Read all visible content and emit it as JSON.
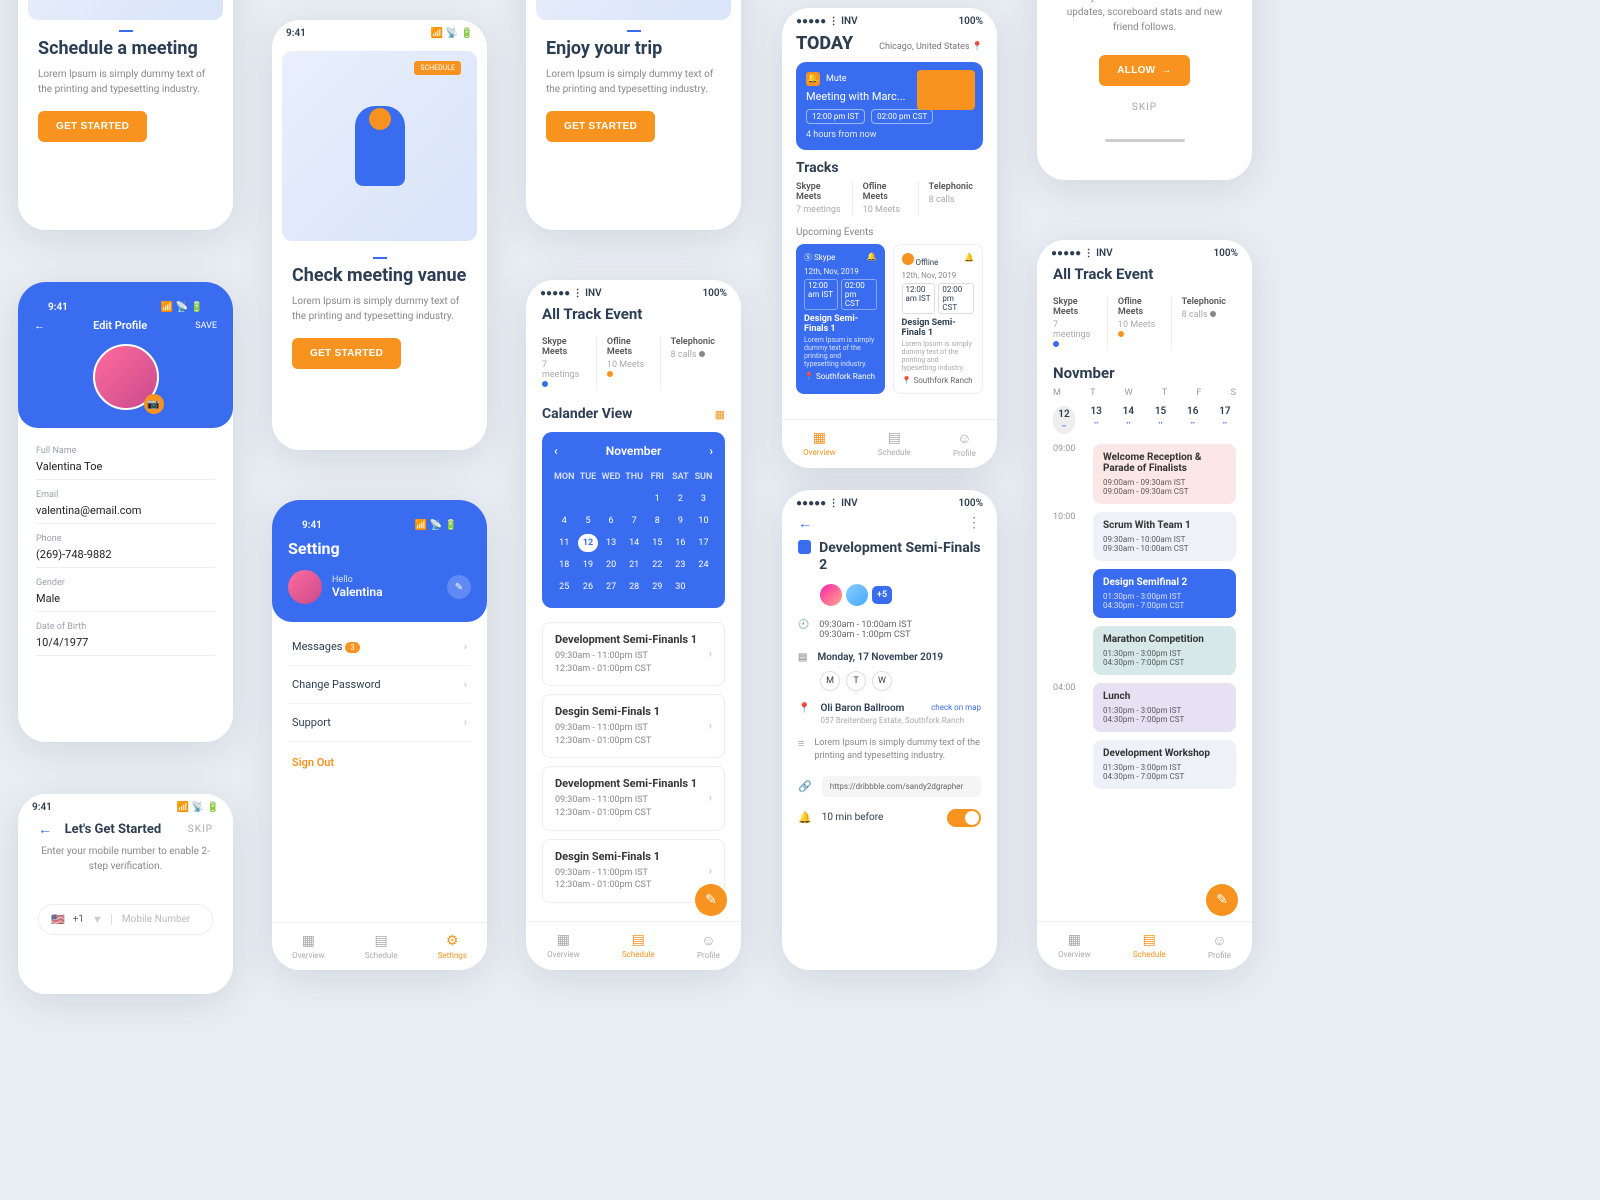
{
  "common": {
    "lorem": "Lorem Ipsum is simply dummy text of the printing and typesetting industry.",
    "getStarted": "GET STARTED"
  },
  "s1": {
    "title": "Schedule a meeting"
  },
  "s2": {
    "title": "Check meeting vanue"
  },
  "s3": {
    "title": "Enjoy your trip"
  },
  "edit": {
    "time": "9:41",
    "header": "Edit Profile",
    "save": "SAVE",
    "back": "←",
    "labels": {
      "name": "Full Name",
      "email": "Email",
      "phone": "Phone",
      "gender": "Gender",
      "dob": "Date of Birth"
    },
    "vals": {
      "name": "Valentina Toe",
      "email": "valentina@email.com",
      "phone": "(269)-748-9882",
      "gender": "Male",
      "dob": "10/4/1977"
    }
  },
  "setting": {
    "time": "9:41",
    "title": "Setting",
    "hello": "Hello",
    "user": "Valentina",
    "messages": "Messages",
    "msgBadge": "3",
    "changePw": "Change Password",
    "support": "Support",
    "signOut": "Sign Out",
    "nav": {
      "overview": "Overview",
      "schedule": "Schedule",
      "settings": "Settings"
    }
  },
  "getStart": {
    "time": "9:41",
    "skip": "SKIP",
    "title": "Let's Get Started",
    "sub": "Enter your mobile number to enable 2-step verification.",
    "code": "+1",
    "ph": "Mobile Number"
  },
  "calview": {
    "sb": "●●●●● ⋮ INV",
    "bat": "100%",
    "title": "All Track Event",
    "tracks": [
      {
        "n": "Skype Meets",
        "c": "7 meetings"
      },
      {
        "n": "Ofline Meets",
        "c": "10 Meets"
      },
      {
        "n": "Telephonic",
        "c": "8 calls"
      }
    ],
    "calTitle": "Calander View",
    "month": "November",
    "wd": [
      "MON",
      "TUE",
      "WED",
      "THU",
      "FRI",
      "SAT",
      "SUN"
    ],
    "days": [
      "",
      "",
      "",
      "",
      "1",
      "2",
      "3",
      "4",
      "5",
      "6",
      "7",
      "8",
      "9",
      "10",
      "11",
      "12",
      "13",
      "14",
      "15",
      "16",
      "17",
      "18",
      "19",
      "20",
      "21",
      "22",
      "23",
      "24",
      "25",
      "26",
      "27",
      "28",
      "29",
      "30",
      ""
    ],
    "sel": "12",
    "events": [
      {
        "t": "Development Semi-Finanls 1",
        "a": "09:30am - 11:00pm IST",
        "b": "12:30am - 01:00pm CST"
      },
      {
        "t": "Desgin Semi-Finals 1",
        "a": "09:30am - 11:00pm IST",
        "b": "12:30am - 01:00pm CST"
      },
      {
        "t": "Development Semi-Finanls 1",
        "a": "09:30am - 11:00pm IST",
        "b": "12:30am - 01:00pm CST"
      },
      {
        "t": "Desgin Semi-Finals 1",
        "a": "09:30am - 11:00pm IST",
        "b": "12:30am - 01:00pm CST"
      }
    ],
    "nav": {
      "overview": "Overview",
      "schedule": "Schedule",
      "profile": "Profile"
    }
  },
  "today": {
    "sb": "●●●●● ⋮ INV",
    "bat": "100%",
    "title": "TODAY",
    "loc": "Chicago, United States",
    "mute": "Mute",
    "meeting": "Meeting with Marc...",
    "t1": "12:00 pm IST",
    "t2": "02:00 pm CST",
    "countdown": "4 hours from now",
    "tracksH": "Tracks",
    "tracks": [
      {
        "n": "Skype Meets",
        "c": "7 meetings"
      },
      {
        "n": "Ofline Meets",
        "c": "10 Meets"
      },
      {
        "n": "Telephonic",
        "c": "8 calls"
      }
    ],
    "upH": "Upcoming Events",
    "up1": {
      "tag": "Skype",
      "date": "12th, Nov, 2019",
      "t1": "12:00 am IST",
      "t2": "02:00 pm CST",
      "ttl": "Design Semi-Finals 1",
      "loc": "Southfork Ranch"
    },
    "up2": {
      "tag": "Offline",
      "date": "12th, Nov, 2019",
      "t1": "12:00 am IST",
      "t2": "02:00 pm CST",
      "ttl": "Design Semi-Finals 1",
      "loc": "Southfork Ranch"
    },
    "nav": {
      "overview": "Overview",
      "schedule": "Schedule",
      "profile": "Profile"
    }
  },
  "detail": {
    "sb": "●●●●● ⋮ INV",
    "bat": "100%",
    "back": "←",
    "more": "⋮",
    "title": "Development Semi-Finals 2",
    "plus": "+5",
    "time": "09:30am - 10:00am IST",
    "time2": "09:30am - 1:00pm CST",
    "date": "Monday, 17 November 2019",
    "days": [
      "M",
      "T",
      "W"
    ],
    "place": "Oli Baron Ballroom",
    "map": "check on map",
    "addr": "057 Breitenberg Estate, Southfork Ranch",
    "url": "https://dribbble.com/sandy2dgrapher",
    "remind": "10 min before"
  },
  "notify": {
    "sub": "Stay notified about new course updates, scoreboard stats and new friend follows.",
    "allow": "ALLOW",
    "skip": "SKIP"
  },
  "sched": {
    "sb": "●●●●● ⋮ INV",
    "bat": "100%",
    "title": "All Track Event",
    "tracks": [
      {
        "n": "Skype Meets",
        "c": "7 meetings"
      },
      {
        "n": "Ofline Meets",
        "c": "10 Meets"
      },
      {
        "n": "Telephonic",
        "c": "8 calls"
      }
    ],
    "month": "Novmber",
    "wd": [
      "M",
      "T",
      "W",
      "T",
      "F",
      "S"
    ],
    "dd": [
      "12",
      "13",
      "14",
      "15",
      "16",
      "17"
    ],
    "act": "12",
    "hours": [
      "09:00",
      "10:00",
      "",
      "",
      "04:00"
    ],
    "cards": [
      {
        "bg": "#fce7e7",
        "ttl": "Welcome Reception & Parade of Finalists",
        "a": "09:00am - 09:30am IST",
        "b": "09:00am - 09:30am CST"
      },
      {
        "bg": "#eef1f7",
        "ttl": "Scrum With Team 1",
        "a": "09:30am - 10:00am IST",
        "b": "09:30am - 10:00am CST"
      },
      {
        "bg": "#3a6cf0",
        "col": "#fff",
        "ttl": "Design Semifinal 2",
        "a": "01:30pm - 3:00pm IST",
        "b": "04:30pm - 7:00pm CST"
      },
      {
        "bg": "#d6e8e8",
        "ttl": "Marathon Competition",
        "a": "01:30pm - 3:00pm IST",
        "b": "04:30pm - 7:00pm CST"
      },
      {
        "bg": "#e6e2f3",
        "ttl": "Lunch",
        "a": "01:30pm - 3:00pm IST",
        "b": "04:30pm - 7:00pm CST"
      },
      {
        "bg": "#eef1f7",
        "ttl": "Development Workshop",
        "a": "01:30pm - 3:00pm IST",
        "b": "04:30pm - 7:00pm CST"
      }
    ],
    "nav": {
      "overview": "Overview",
      "schedule": "Schedule",
      "profile": "Profile"
    }
  }
}
